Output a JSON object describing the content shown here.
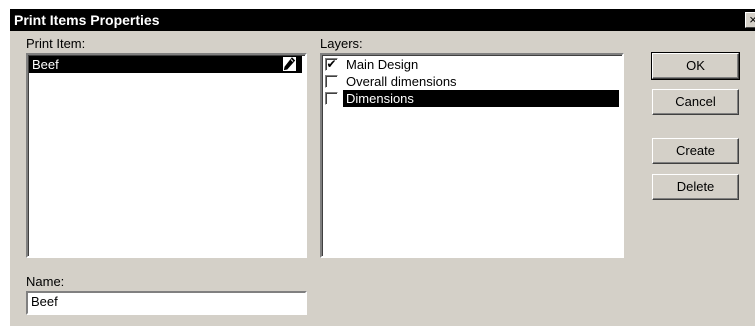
{
  "window": {
    "title": "Print Items Properties",
    "close_glyph": "×"
  },
  "print_item": {
    "label": "Print Item:",
    "items": [
      {
        "label": "Beef",
        "selected": true,
        "icon": "pencil-icon"
      }
    ]
  },
  "layers": {
    "label": "Layers:",
    "items": [
      {
        "label": "Main Design",
        "checked": true,
        "selected": false
      },
      {
        "label": "Overall dimensions",
        "checked": false,
        "selected": false
      },
      {
        "label": "Dimensions",
        "checked": false,
        "selected": true
      }
    ]
  },
  "buttons": {
    "ok": "OK",
    "cancel": "Cancel",
    "create": "Create",
    "delete": "Delete"
  },
  "name": {
    "label": "Name:",
    "value": "Beef"
  },
  "colors": {
    "face": "#d4d0c8",
    "selection": "#000000",
    "titlebar": "#000000"
  }
}
